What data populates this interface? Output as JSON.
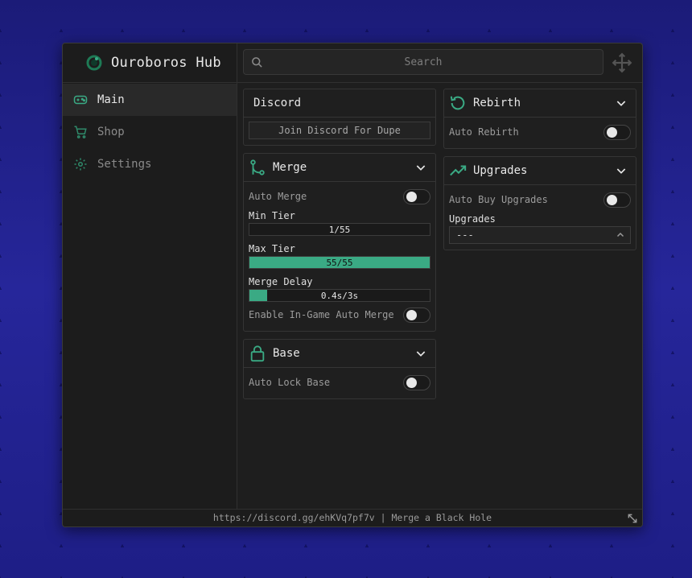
{
  "app": {
    "title": "Ouroboros Hub"
  },
  "search": {
    "placeholder": "Search"
  },
  "sidebar": {
    "items": [
      {
        "label": "Main",
        "icon": "gamepad-icon",
        "active": true
      },
      {
        "label": "Shop",
        "icon": "cart-icon",
        "active": false
      },
      {
        "label": "Settings",
        "icon": "gear-icon",
        "active": false
      }
    ]
  },
  "sections": {
    "discord": {
      "title": "Discord",
      "button": "Join Discord For Dupe"
    },
    "merge": {
      "title": "Merge",
      "auto_merge": {
        "label": "Auto Merge",
        "on": false
      },
      "min_tier": {
        "label": "Min Tier",
        "value": 1,
        "max": 55,
        "text": "1/55"
      },
      "max_tier": {
        "label": "Max Tier",
        "value": 55,
        "max": 55,
        "text": "55/55"
      },
      "merge_delay": {
        "label": "Merge Delay",
        "value": 0.4,
        "max": 3,
        "text": "0.4s/3s"
      },
      "ingame_auto": {
        "label": "Enable In-Game Auto Merge",
        "on": false
      }
    },
    "base": {
      "title": "Base",
      "auto_lock": {
        "label": "Auto Lock Base",
        "on": false
      }
    },
    "rebirth": {
      "title": "Rebirth",
      "auto_rebirth": {
        "label": "Auto Rebirth",
        "on": false
      }
    },
    "upgrades": {
      "title": "Upgrades",
      "auto_buy": {
        "label": "Auto Buy Upgrades",
        "on": false
      },
      "dropdown_label": "Upgrades",
      "dropdown_value": "---"
    }
  },
  "footer": {
    "text": "https://discord.gg/ehKVq7pf7v | Merge a Black Hole"
  },
  "colors": {
    "accent": "#3aaa84",
    "window": "#1e1e1e",
    "background": "#22228e"
  }
}
